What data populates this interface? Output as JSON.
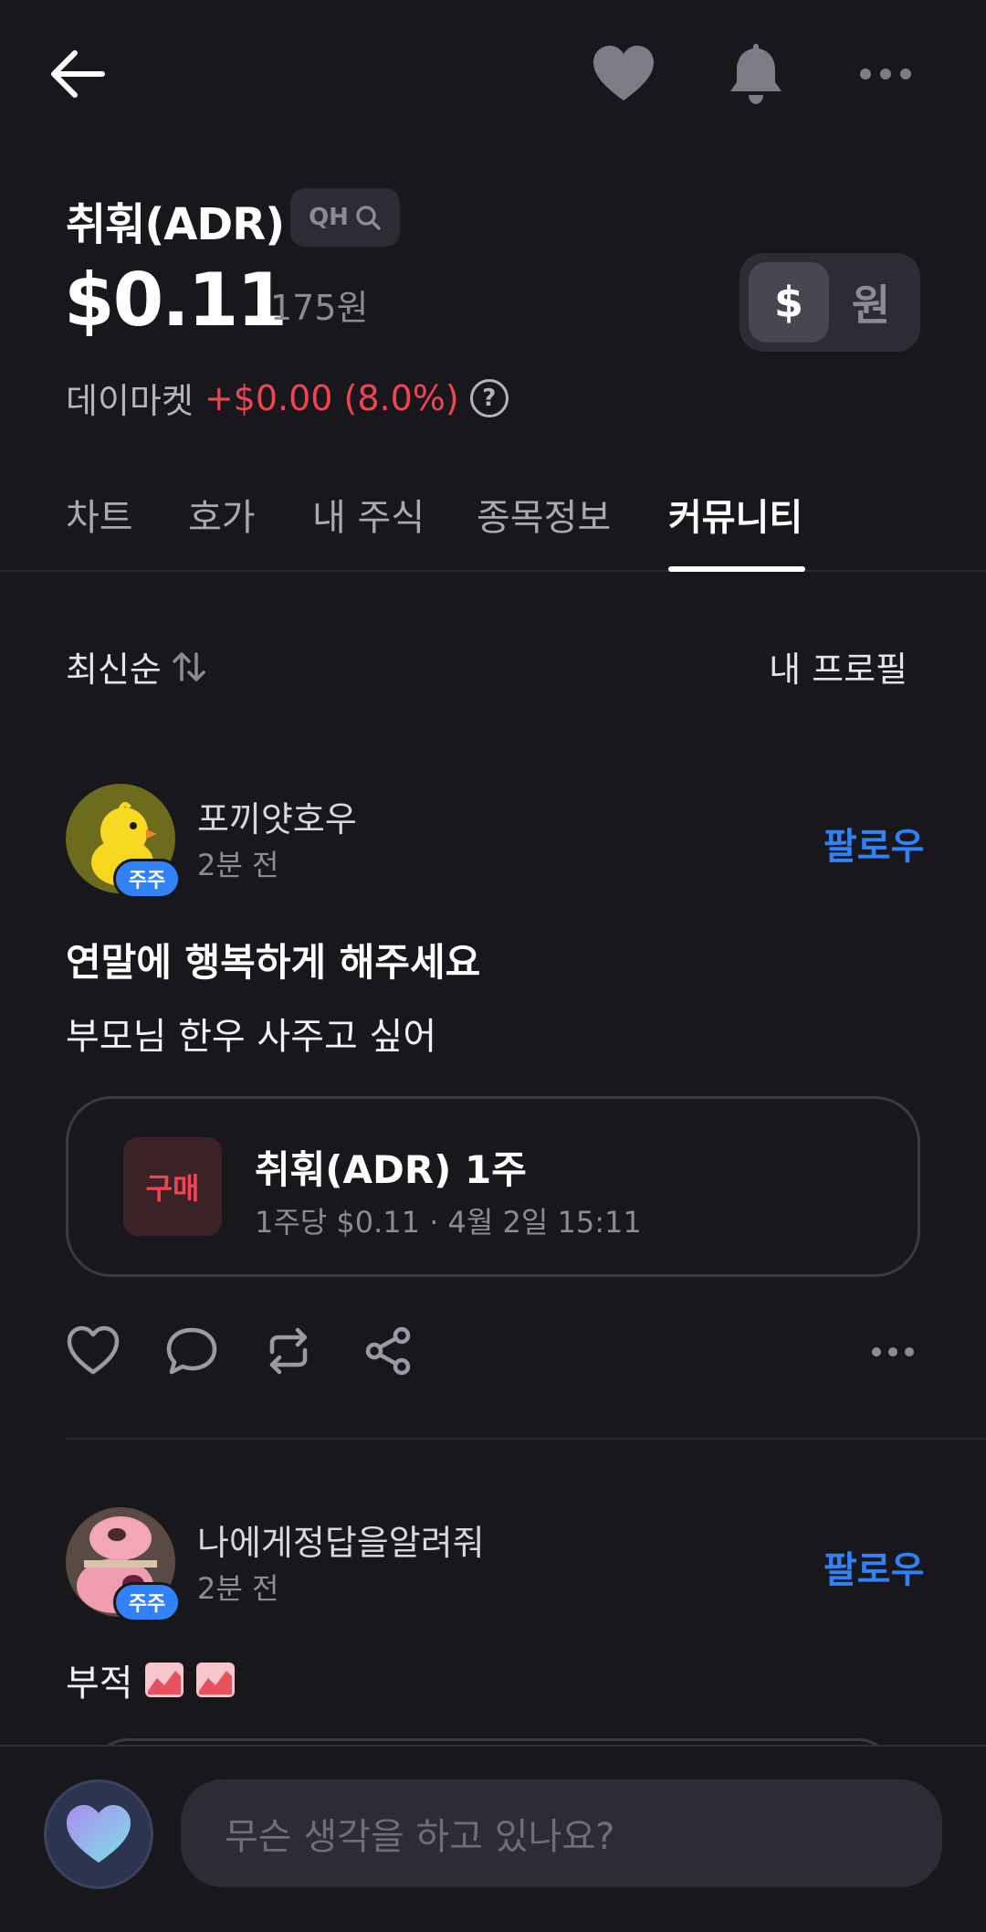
{
  "topbar": {
    "icons": [
      "back-arrow-icon",
      "heart-icon",
      "bell-icon",
      "more-horizontal-icon"
    ]
  },
  "header": {
    "stock_name": "취훠(ADR)",
    "ticker_chip": "QH",
    "price": "$0.11",
    "price_krw": "175원",
    "currency_options": [
      "$",
      "원"
    ],
    "selected_currency": "$",
    "daymarket_label": "데이마켓",
    "daymarket_change": "+$0.00 (8.0%)",
    "help_symbol": "?"
  },
  "tabs": [
    {
      "label": "차트"
    },
    {
      "label": "호가"
    },
    {
      "label": "내 주식"
    },
    {
      "label": "종목정보"
    },
    {
      "label": "커뮤니티"
    }
  ],
  "active_tab": "커뮤니티",
  "sort": {
    "label": "최신순",
    "profile_link": "내 프로필"
  },
  "posts": [
    {
      "author": "포끼얏호우",
      "time": "2분 전",
      "badge": "주주",
      "follow": "팔로우",
      "title": "연말에 행복하게 해주세요",
      "body": "부모님 한우 사주고 싶어",
      "trade": {
        "tag": "구매",
        "title": "취훠(ADR) 1주",
        "detail": "1주당 $0.11 · 4월 2일 15:11"
      }
    },
    {
      "author": "나에게정답을알려줘",
      "time": "2분 전",
      "badge": "주주",
      "follow": "팔로우",
      "body": "부적"
    }
  ],
  "composer": {
    "placeholder": "무슨 생각을 하고 있나요?"
  },
  "colors": {
    "background": "#17171c",
    "accent_blue": "#3182f6",
    "rise_red": "#f04452",
    "muted_text": "#8b8b96"
  }
}
